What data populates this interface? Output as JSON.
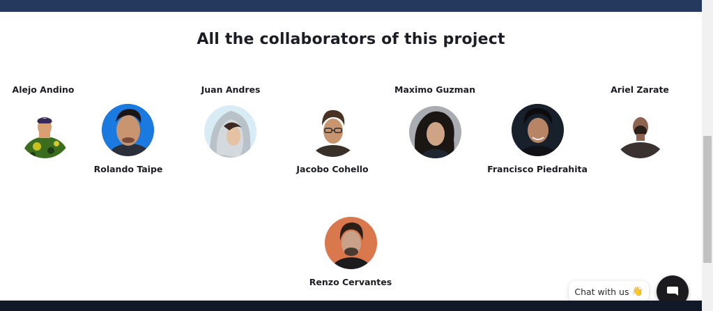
{
  "section": {
    "title": "All the collaborators of this project"
  },
  "collaborators": [
    {
      "name": "Alejo Andino"
    },
    {
      "name": "Rolando Taipe"
    },
    {
      "name": "Juan Andres"
    },
    {
      "name": "Jacobo Cohello"
    },
    {
      "name": "Maximo Guzman"
    },
    {
      "name": "Francisco Piedrahita"
    },
    {
      "name": "Ariel Zarate"
    },
    {
      "name": "Renzo Cervantes"
    }
  ],
  "chat": {
    "label": "Chat with us",
    "emoji": "👋",
    "button_icon": "chat-bubble-icon"
  },
  "colors": {
    "header_bar": "#25385e",
    "footer_bar": "#111827",
    "chat_button": "#1b1b1f"
  }
}
